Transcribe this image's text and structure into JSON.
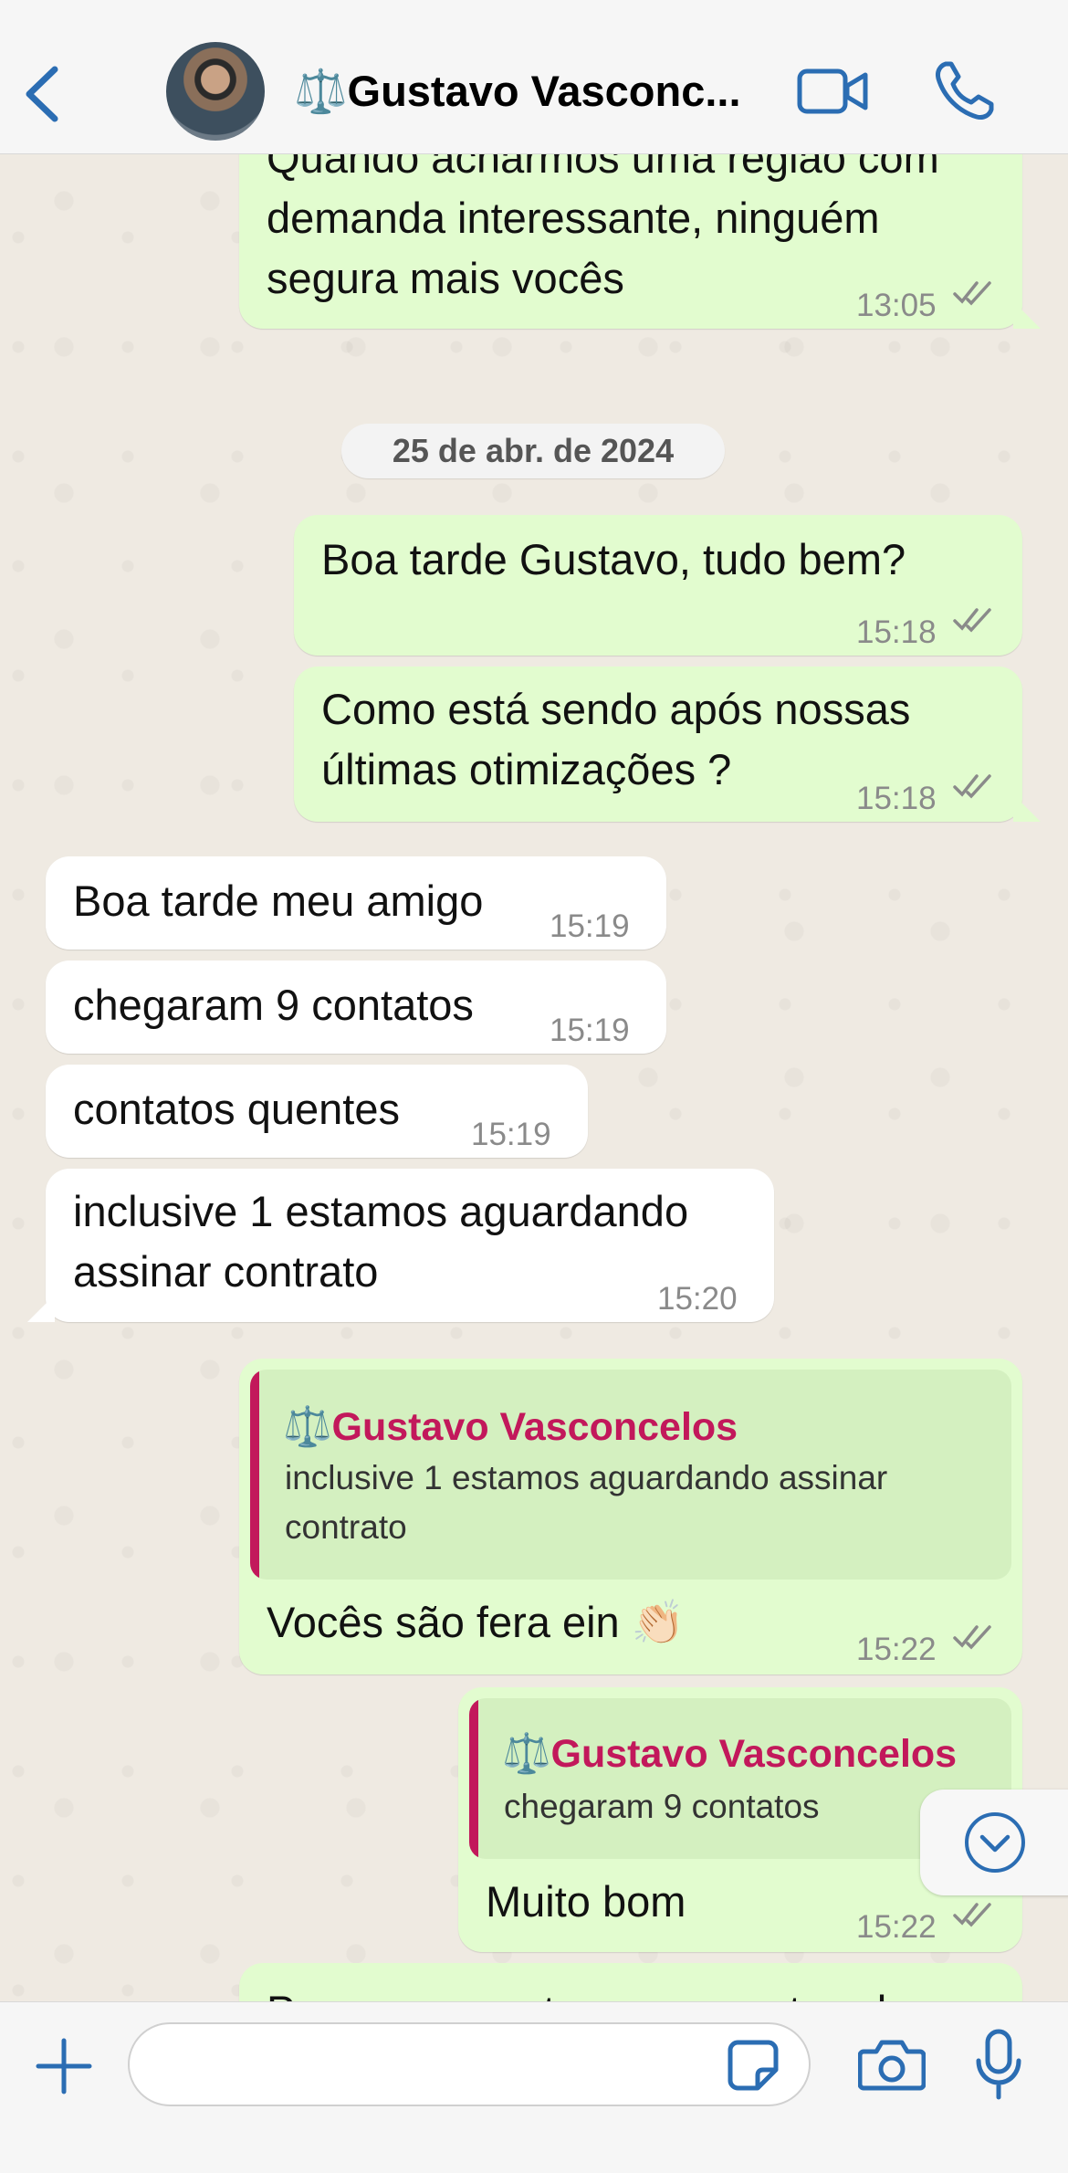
{
  "header": {
    "contact_name": "⚖️Gustavo Vasconc..."
  },
  "chat": {
    "messages": [
      {
        "text_lines": [
          "Quando acharmos uma região com",
          "demanda interessante, ninguém",
          "segura mais vocês"
        ],
        "time": "13:05"
      },
      {
        "date": "25 de abr. de 2024"
      },
      {
        "text": "Boa tarde Gustavo, tudo bem?",
        "time": "15:18"
      },
      {
        "text_lines": [
          "Como está sendo após nossas",
          "últimas otimizações ?"
        ],
        "time": "15:18"
      },
      {
        "text": "Boa tarde meu amigo",
        "time": "15:19"
      },
      {
        "text": "chegaram 9 contatos",
        "time": "15:19"
      },
      {
        "text": "contatos quentes",
        "time": "15:19"
      },
      {
        "text_lines": [
          "inclusive 1 estamos aguardando",
          "assinar contrato"
        ],
        "time": "15:20"
      },
      {
        "quote_name": "⚖️Gustavo Vasconcelos",
        "quote_lines": [
          "inclusive 1 estamos aguardando assinar",
          "contrato"
        ],
        "text": "Vocês são fera ein 👏🏻",
        "time": "15:22"
      },
      {
        "quote_name": "⚖️Gustavo Vasconcelos",
        "quote_text": "chegaram 9 contatos",
        "text": "Muito bom",
        "time": "15:22"
      },
      {
        "text": "Parece que estamos encontrando"
      }
    ]
  },
  "colors": {
    "accent": "#2b6db3",
    "outgoing_bubble": "#e2fccf",
    "incoming_bubble": "#ffffff",
    "quote_name": "#c2185b",
    "chat_background": "#efeae2"
  },
  "icons": [
    "back-chevron-icon",
    "video-camera-icon",
    "phone-icon",
    "chevron-down-icon",
    "plus-icon",
    "sticker-icon",
    "camera-icon",
    "microphone-icon",
    "double-check-icon"
  ],
  "input": {
    "placeholder": ""
  }
}
